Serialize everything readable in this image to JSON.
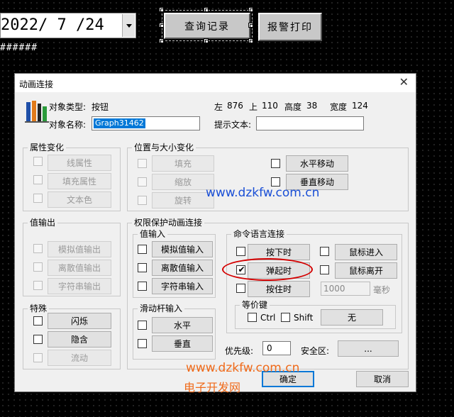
{
  "background": {
    "date_value": "2022/ 7 /24",
    "hash_text": "######",
    "query_button": "查询记录",
    "alarm_button": "报警打印"
  },
  "dialog": {
    "title": "动画连接",
    "object_type_label": "对象类型:",
    "object_type_value": "按钮",
    "object_name_label": "对象名称:",
    "object_name_value": "Graph31462",
    "left_label": "左",
    "left_value": "876",
    "top_label": "上",
    "top_value": "110",
    "height_label": "高度",
    "height_value": "38",
    "width_label": "宽度",
    "width_value": "124",
    "hint_label": "提示文本:",
    "hint_value": ""
  },
  "attr_group": {
    "title": "属性变化",
    "items": [
      "线属性",
      "填充属性",
      "文本色"
    ]
  },
  "position_group": {
    "title": "位置与大小变化",
    "items": [
      "填充",
      "缩放",
      "旋转",
      "水平移动",
      "垂直移动"
    ]
  },
  "value_output_group": {
    "title": "值输出",
    "items": [
      "模拟值输出",
      "离散值输出",
      "字符串输出"
    ]
  },
  "special_group": {
    "title": "特殊",
    "items": [
      "闪烁",
      "隐含",
      "流动"
    ]
  },
  "permission_group": {
    "title": "权限保护动画连接"
  },
  "value_input_group": {
    "title": "值输入",
    "items": [
      "模拟值输入",
      "离散值输入",
      "字符串输入"
    ]
  },
  "slider_group": {
    "title": "滑动杆输入",
    "items": [
      "水平",
      "垂直"
    ]
  },
  "command_group": {
    "title": "命令语言连接",
    "press": "按下时",
    "release": "弹起时",
    "hold": "按住时",
    "mouse_enter": "鼠标进入",
    "mouse_leave": "鼠标离开",
    "hold_interval": "1000",
    "ms_label": "毫秒"
  },
  "hotkey_group": {
    "title": "等价键",
    "ctrl": "Ctrl",
    "shift": "Shift",
    "key_button": "无"
  },
  "footer": {
    "priority_label": "优先级:",
    "priority_value": "0",
    "security_label": "安全区:",
    "security_button": "...",
    "ok": "确定",
    "cancel": "取消"
  },
  "watermarks": {
    "site1": "www.dzkfw.com.cn",
    "site2": "www.dzkfw.com.cn",
    "site_name": "电子开发网"
  },
  "colors": {
    "selection_blue": "#0078d7",
    "highlight_red": "#d40000",
    "watermark_blue": "#1a4fd6",
    "watermark_orange": "#ef6a1a"
  }
}
